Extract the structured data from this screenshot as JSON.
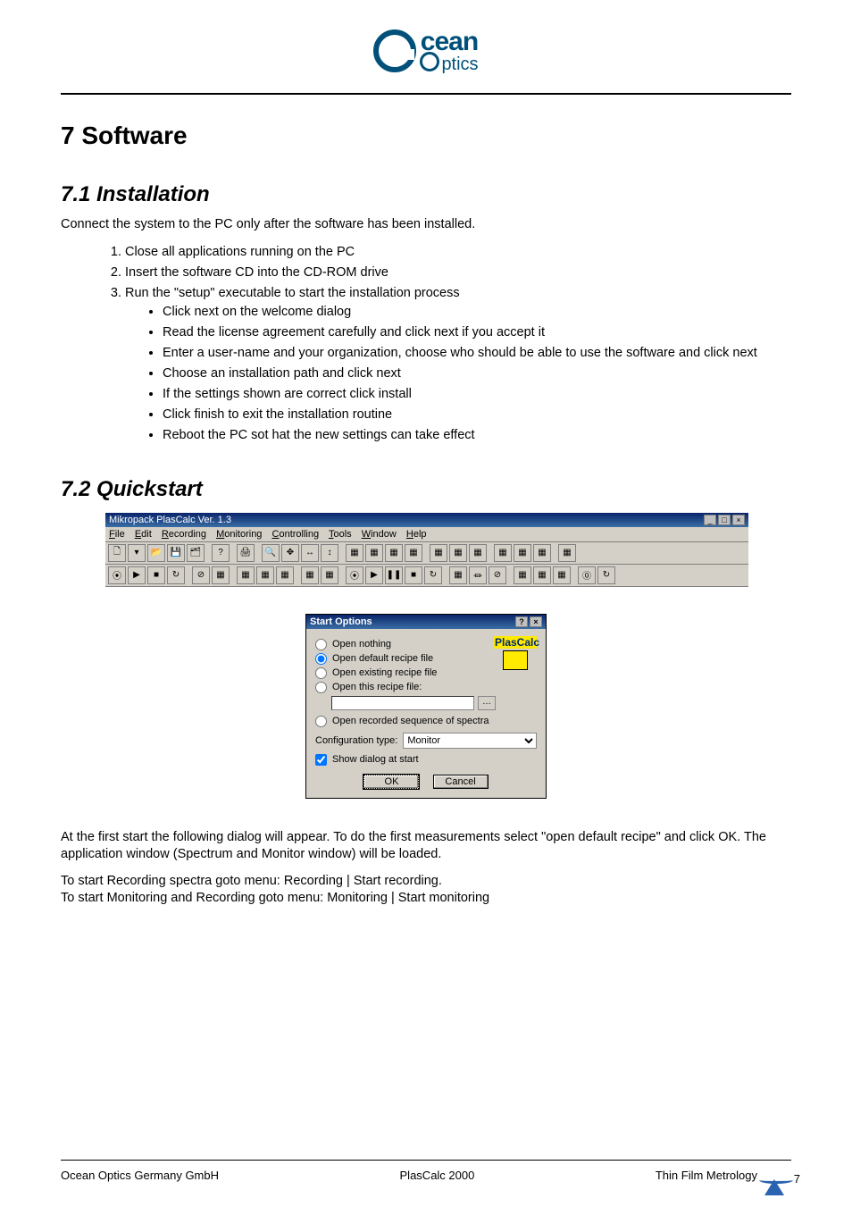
{
  "logo": {
    "brand_top": "cean",
    "brand_bottom": "ptics"
  },
  "h1": "7  Software",
  "h2_install": "7.1   Installation",
  "install_intro": "Connect the system to the PC only after the software has been installed.",
  "steps": [
    "Close all applications running on the PC",
    "Insert the software CD into the CD-ROM drive",
    "Run the \"setup\" executable to start the installation process"
  ],
  "substeps": [
    "Click next on the welcome dialog",
    "Read the license agreement carefully and click next if you accept it",
    "Enter a user-name and your organization, choose who should be able to use the software and click next",
    "Choose an installation path and click next",
    "If the settings shown are correct click install",
    "Click finish to exit the installation routine",
    "Reboot the PC sot hat the new settings can take effect"
  ],
  "h2_quick": "7.2   Quickstart",
  "app": {
    "title": "Mikropack PlasCalc Ver. 1.3",
    "menus": [
      "File",
      "Edit",
      "Recording",
      "Monitoring",
      "Controlling",
      "Tools",
      "Window",
      "Help"
    ]
  },
  "dialog": {
    "title": "Start Options",
    "opt_nothing": "Open nothing",
    "opt_default": "Open default recipe file",
    "opt_existing": "Open existing recipe file",
    "opt_this": "Open this recipe file:",
    "opt_seq": "Open recorded sequence of spectra",
    "cfg_label": "Configuration type:",
    "cfg_value": "Monitor",
    "show_label": "Show dialog at start",
    "ok": "OK",
    "cancel": "Cancel",
    "logo_text": "PlasCalc"
  },
  "body_after": [
    "At the first start the following dialog will appear. To do the first measurements select \"open default recipe\" and click OK. The application window (Spectrum and Monitor window) will be loaded.",
    "To start Recording spectra goto menu: Recording | Start recording.",
    "To start Monitoring and Recording goto menu: Monitoring | Start monitoring"
  ],
  "footer": {
    "left": "Ocean Optics Germany GmbH",
    "center": "PlasCalc 2000",
    "right": "Thin Film Metrology",
    "page": "7"
  }
}
